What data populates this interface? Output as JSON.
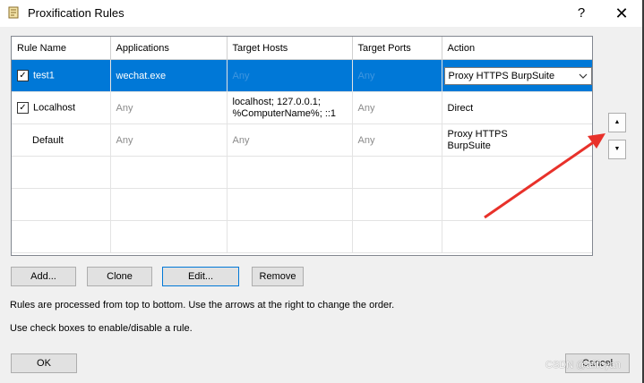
{
  "window": {
    "title": "Proxification Rules",
    "help_label": "?",
    "close_label": "✕"
  },
  "table": {
    "columns": [
      "Rule Name",
      "Applications",
      "Target Hosts",
      "Target Ports",
      "Action"
    ],
    "rows": [
      {
        "checked": true,
        "name": "test1",
        "applications": "wechat.exe",
        "target_hosts": "Any",
        "target_ports": "Any",
        "action": "Proxy HTTPS BurpSuite",
        "selected": true
      },
      {
        "checked": true,
        "name": "Localhost",
        "applications": "Any",
        "target_hosts": "localhost; 127.0.0.1; %ComputerName%; ::1",
        "target_ports": "Any",
        "action": "Direct",
        "selected": false
      },
      {
        "checked": false,
        "name": "Default",
        "applications": "Any",
        "target_hosts": "Any",
        "target_ports": "Any",
        "action": "Proxy HTTPS BurpSuite",
        "selected": false
      }
    ]
  },
  "buttons": {
    "add": "Add...",
    "clone": "Clone",
    "edit": "Edit...",
    "remove": "Remove",
    "ok": "OK",
    "cancel": "Cancel",
    "move_up": "▲",
    "move_down": "▼"
  },
  "notes": {
    "order": "Rules are processed from top to bottom. Use the arrows at the right to change the order.",
    "checkbox": "Use check boxes to enable/disable a rule."
  },
  "watermark": "CSDN @afifoyan",
  "colors": {
    "selection": "#0078d7",
    "annotation_arrow": "#e8312a"
  },
  "icons": {
    "window": "rules-document-icon",
    "dropdown": "chevron-down-icon",
    "checkbox": "checkmark-icon"
  }
}
